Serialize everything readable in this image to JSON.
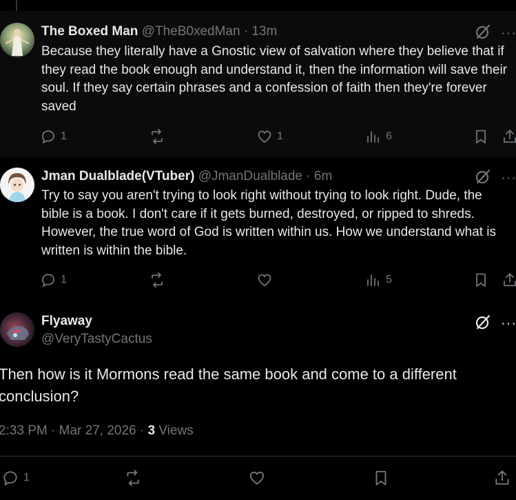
{
  "replies": [
    {
      "name": "The Boxed Man",
      "handle": "@TheB0xedMan",
      "time": "13m",
      "text": "Because they literally have a Gnostic view of salvation where they believe that if they read the book enough and understand it, then the information will save their soul. If they say certain phrases and a confession of faith then they're forever saved",
      "replies_count": "1",
      "reposts_count": "",
      "likes_count": "1",
      "views_count": "6",
      "avatar_icon": "religious-figure-avatar"
    },
    {
      "name": "Jman Dualblade(VTuber)",
      "handle": "@JmanDualblade",
      "time": "6m",
      "text": "Try to say you aren't trying to look right without trying to look right. Dude, the bible is a book. I don't care if it gets burned, destroyed, or ripped to shreds. However, the true word of God is written within us. How we understand what is written is within the bible.",
      "replies_count": "1",
      "reposts_count": "",
      "likes_count": "",
      "views_count": "5",
      "avatar_icon": "anime-character-avatar"
    }
  ],
  "main_post": {
    "name": "Flyaway",
    "handle": "@VeryTastyCactus",
    "text": "Then how is it Mormons read the same book and come to a different conclusion?",
    "timestamp": "2:33 PM · Mar 27, 2026 · ",
    "views_count": "3",
    "views_label": " Views",
    "replies_count": "1",
    "avatar_icon": "robot-avatar"
  },
  "separator_dot": "·",
  "more_label": "···",
  "colors": {
    "background": "#000000",
    "reply_background": "#0b0b0b",
    "text": "#e7e9ea",
    "muted": "#71767b",
    "divider": "#2f3336"
  }
}
